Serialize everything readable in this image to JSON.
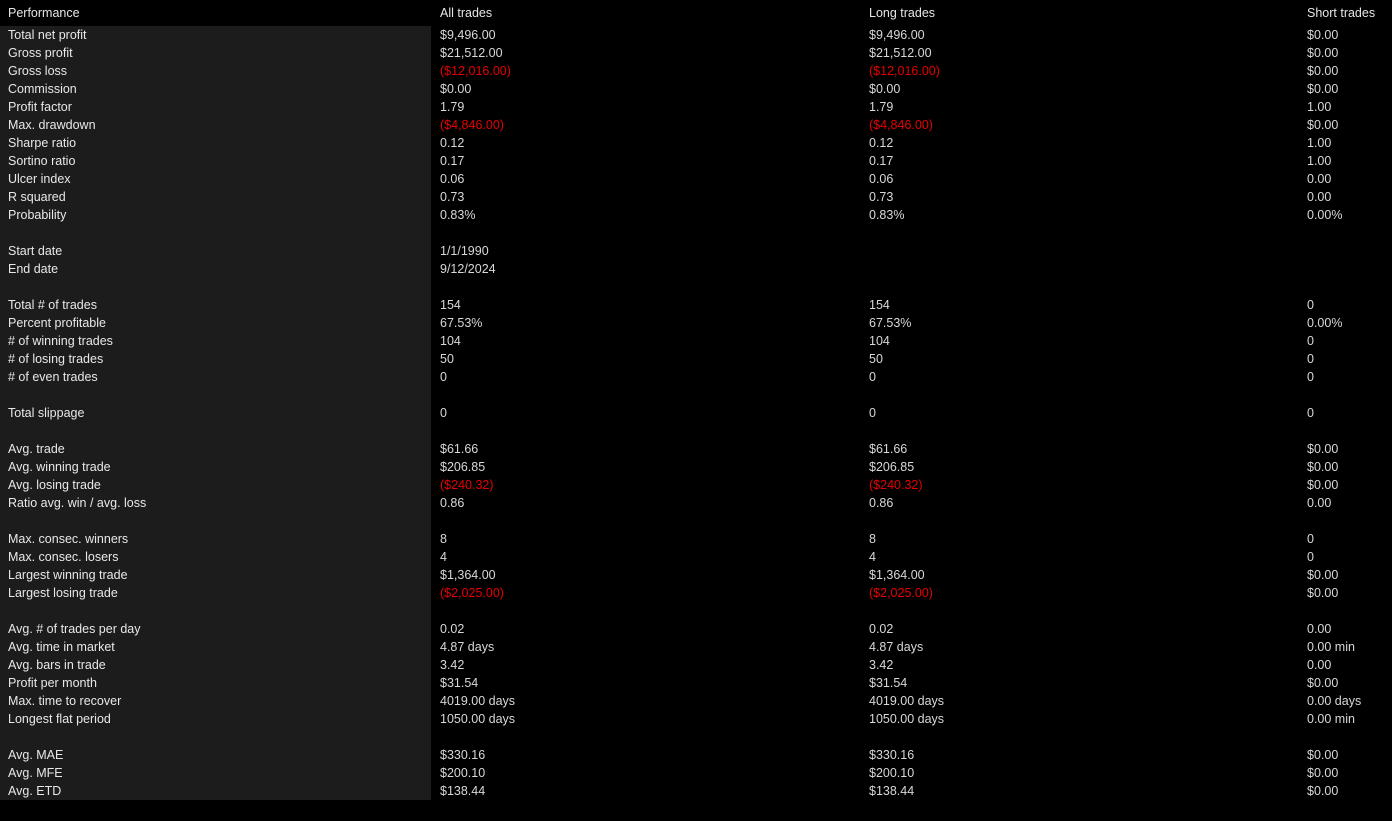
{
  "report": {
    "title": "Performance",
    "columns": [
      "Performance",
      "All trades",
      "Long trades",
      "Short trades"
    ],
    "colors": {
      "background": "#000000",
      "name_panel": "#1c1c1c",
      "text": "#e8e8e8",
      "value": "#d8d8d8",
      "negative": "#e60000"
    },
    "groups": [
      {
        "rows": [
          {
            "name": "Total net profit",
            "all": "$9,496.00",
            "long": "$9,496.00",
            "short": "$0.00",
            "all_neg": false,
            "long_neg": false,
            "short_neg": false
          },
          {
            "name": "Gross profit",
            "all": "$21,512.00",
            "long": "$21,512.00",
            "short": "$0.00",
            "all_neg": false,
            "long_neg": false,
            "short_neg": false
          },
          {
            "name": "Gross loss",
            "all": "($12,016.00)",
            "long": "($12,016.00)",
            "short": "$0.00",
            "all_neg": true,
            "long_neg": true,
            "short_neg": false
          },
          {
            "name": "Commission",
            "all": "$0.00",
            "long": "$0.00",
            "short": "$0.00",
            "all_neg": false,
            "long_neg": false,
            "short_neg": false
          },
          {
            "name": "Profit factor",
            "all": "1.79",
            "long": "1.79",
            "short": "1.00",
            "all_neg": false,
            "long_neg": false,
            "short_neg": false
          },
          {
            "name": "Max. drawdown",
            "all": "($4,846.00)",
            "long": "($4,846.00)",
            "short": "$0.00",
            "all_neg": true,
            "long_neg": true,
            "short_neg": false
          },
          {
            "name": "Sharpe ratio",
            "all": "0.12",
            "long": "0.12",
            "short": "1.00",
            "all_neg": false,
            "long_neg": false,
            "short_neg": false
          },
          {
            "name": "Sortino ratio",
            "all": "0.17",
            "long": "0.17",
            "short": "1.00",
            "all_neg": false,
            "long_neg": false,
            "short_neg": false
          },
          {
            "name": "Ulcer index",
            "all": "0.06",
            "long": "0.06",
            "short": "0.00",
            "all_neg": false,
            "long_neg": false,
            "short_neg": false
          },
          {
            "name": "R squared",
            "all": "0.73",
            "long": "0.73",
            "short": "0.00",
            "all_neg": false,
            "long_neg": false,
            "short_neg": false
          },
          {
            "name": "Probability",
            "all": "0.83%",
            "long": "0.83%",
            "short": "0.00%",
            "all_neg": false,
            "long_neg": false,
            "short_neg": false
          }
        ]
      },
      {
        "rows": [
          {
            "name": "Start date",
            "all": "1/1/1990",
            "long": "",
            "short": "",
            "all_neg": false,
            "long_neg": false,
            "short_neg": false
          },
          {
            "name": "End date",
            "all": "9/12/2024",
            "long": "",
            "short": "",
            "all_neg": false,
            "long_neg": false,
            "short_neg": false
          }
        ]
      },
      {
        "rows": [
          {
            "name": "Total # of trades",
            "all": "154",
            "long": "154",
            "short": "0",
            "all_neg": false,
            "long_neg": false,
            "short_neg": false
          },
          {
            "name": "Percent profitable",
            "all": "67.53%",
            "long": "67.53%",
            "short": "0.00%",
            "all_neg": false,
            "long_neg": false,
            "short_neg": false
          },
          {
            "name": "# of winning trades",
            "all": "104",
            "long": "104",
            "short": "0",
            "all_neg": false,
            "long_neg": false,
            "short_neg": false
          },
          {
            "name": "# of losing trades",
            "all": "50",
            "long": "50",
            "short": "0",
            "all_neg": false,
            "long_neg": false,
            "short_neg": false
          },
          {
            "name": "# of even trades",
            "all": "0",
            "long": "0",
            "short": "0",
            "all_neg": false,
            "long_neg": false,
            "short_neg": false
          }
        ]
      },
      {
        "rows": [
          {
            "name": "Total slippage",
            "all": "0",
            "long": "0",
            "short": "0",
            "all_neg": false,
            "long_neg": false,
            "short_neg": false
          }
        ]
      },
      {
        "rows": [
          {
            "name": "Avg. trade",
            "all": "$61.66",
            "long": "$61.66",
            "short": "$0.00",
            "all_neg": false,
            "long_neg": false,
            "short_neg": false
          },
          {
            "name": "Avg. winning trade",
            "all": "$206.85",
            "long": "$206.85",
            "short": "$0.00",
            "all_neg": false,
            "long_neg": false,
            "short_neg": false
          },
          {
            "name": "Avg. losing trade",
            "all": "($240.32)",
            "long": "($240.32)",
            "short": "$0.00",
            "all_neg": true,
            "long_neg": true,
            "short_neg": false
          },
          {
            "name": "Ratio avg. win / avg. loss",
            "all": "0.86",
            "long": "0.86",
            "short": "0.00",
            "all_neg": false,
            "long_neg": false,
            "short_neg": false
          }
        ]
      },
      {
        "rows": [
          {
            "name": "Max. consec. winners",
            "all": "8",
            "long": "8",
            "short": "0",
            "all_neg": false,
            "long_neg": false,
            "short_neg": false
          },
          {
            "name": "Max. consec. losers",
            "all": "4",
            "long": "4",
            "short": "0",
            "all_neg": false,
            "long_neg": false,
            "short_neg": false
          },
          {
            "name": "Largest winning trade",
            "all": "$1,364.00",
            "long": "$1,364.00",
            "short": "$0.00",
            "all_neg": false,
            "long_neg": false,
            "short_neg": false
          },
          {
            "name": "Largest losing trade",
            "all": "($2,025.00)",
            "long": "($2,025.00)",
            "short": "$0.00",
            "all_neg": true,
            "long_neg": true,
            "short_neg": false
          }
        ]
      },
      {
        "rows": [
          {
            "name": "Avg. # of trades per day",
            "all": "0.02",
            "long": "0.02",
            "short": "0.00",
            "all_neg": false,
            "long_neg": false,
            "short_neg": false
          },
          {
            "name": "Avg. time in market",
            "all": "4.87 days",
            "long": "4.87 days",
            "short": "0.00 min",
            "all_neg": false,
            "long_neg": false,
            "short_neg": false
          },
          {
            "name": "Avg. bars in trade",
            "all": "3.42",
            "long": "3.42",
            "short": "0.00",
            "all_neg": false,
            "long_neg": false,
            "short_neg": false
          },
          {
            "name": "Profit per month",
            "all": "$31.54",
            "long": "$31.54",
            "short": "$0.00",
            "all_neg": false,
            "long_neg": false,
            "short_neg": false
          },
          {
            "name": "Max. time to recover",
            "all": "4019.00 days",
            "long": "4019.00 days",
            "short": "0.00 days",
            "all_neg": false,
            "long_neg": false,
            "short_neg": false
          },
          {
            "name": "Longest flat period",
            "all": "1050.00 days",
            "long": "1050.00 days",
            "short": "0.00 min",
            "all_neg": false,
            "long_neg": false,
            "short_neg": false
          }
        ]
      },
      {
        "rows": [
          {
            "name": "Avg. MAE",
            "all": "$330.16",
            "long": "$330.16",
            "short": "$0.00",
            "all_neg": false,
            "long_neg": false,
            "short_neg": false
          },
          {
            "name": "Avg. MFE",
            "all": "$200.10",
            "long": "$200.10",
            "short": "$0.00",
            "all_neg": false,
            "long_neg": false,
            "short_neg": false
          },
          {
            "name": "Avg. ETD",
            "all": "$138.44",
            "long": "$138.44",
            "short": "$0.00",
            "all_neg": false,
            "long_neg": false,
            "short_neg": false
          }
        ]
      }
    ]
  }
}
